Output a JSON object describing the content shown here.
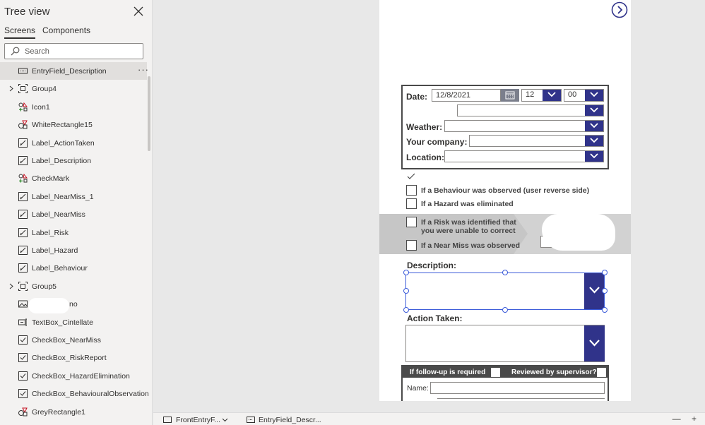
{
  "tree_panel": {
    "title": "Tree view",
    "tabs": [
      "Screens",
      "Components"
    ],
    "search_placeholder": "Search",
    "items": [
      {
        "label": "EntryField_Description",
        "icon": "text-input-icon",
        "selected": true,
        "expandable": false
      },
      {
        "label": "Group4",
        "icon": "group-icon",
        "selected": false,
        "expandable": true
      },
      {
        "label": "Icon1",
        "icon": "icon-control-icon",
        "selected": false,
        "expandable": false
      },
      {
        "label": "WhiteRectangle15",
        "icon": "shape-icon",
        "selected": false,
        "expandable": false
      },
      {
        "label": "Label_ActionTaken",
        "icon": "label-icon",
        "selected": false,
        "expandable": false
      },
      {
        "label": "Label_Description",
        "icon": "label-icon",
        "selected": false,
        "expandable": false
      },
      {
        "label": "CheckMark",
        "icon": "icon-control-icon",
        "selected": false,
        "expandable": false
      },
      {
        "label": "Label_NearMiss_1",
        "icon": "label-icon",
        "selected": false,
        "expandable": false
      },
      {
        "label": "Label_NearMiss",
        "icon": "label-icon",
        "selected": false,
        "expandable": false
      },
      {
        "label": "Label_Risk",
        "icon": "label-icon",
        "selected": false,
        "expandable": false
      },
      {
        "label": "Label_Hazard",
        "icon": "label-icon",
        "selected": false,
        "expandable": false
      },
      {
        "label": "Label_Behaviour",
        "icon": "label-icon",
        "selected": false,
        "expandable": false
      },
      {
        "label": "Group5",
        "icon": "group-icon",
        "selected": false,
        "expandable": true
      },
      {
        "label": "no",
        "icon": "image-icon",
        "selected": false,
        "expandable": false
      },
      {
        "label": "TextBox_Cintellate",
        "icon": "textbox-icon",
        "selected": false,
        "expandable": false
      },
      {
        "label": "CheckBox_NearMiss",
        "icon": "checkbox-icon",
        "selected": false,
        "expandable": false
      },
      {
        "label": "CheckBox_RiskReport",
        "icon": "checkbox-icon",
        "selected": false,
        "expandable": false
      },
      {
        "label": "CheckBox_HazardElimination",
        "icon": "checkbox-icon",
        "selected": false,
        "expandable": false
      },
      {
        "label": "CheckBox_BehaviouralObservation",
        "icon": "checkbox-icon",
        "selected": false,
        "expandable": false
      },
      {
        "label": "GreyRectangle1",
        "icon": "shape-icon",
        "selected": false,
        "expandable": false
      }
    ]
  },
  "form": {
    "date_label": "Date:",
    "date_value": "12/8/2021",
    "hour_value": "12",
    "minute_value": "00",
    "weather_label": "Weather:",
    "company_label": "Your company:",
    "location_label": "Location:",
    "checkboxes": [
      {
        "label": "If a Behaviour was observed (user reverse side)"
      },
      {
        "label": "If a Hazard was eliminated"
      },
      {
        "label": "If a Risk was identified that you were unable to correct"
      },
      {
        "label": "If a Near Miss was observed"
      }
    ],
    "description_label": "Description:",
    "action_label": "Action Taken:",
    "followup_label": "If follow-up is required",
    "supervisor_label": "Reviewed by supervisor?",
    "name_label": "Name:"
  },
  "bottom_bar": {
    "screen_crumb": "FrontEntryF...",
    "control_crumb": "EntryField_Descr...",
    "right_controls": "— +"
  },
  "colors": {
    "accent": "#30338a",
    "selection": "#3b5bd9",
    "panel_bg": "#f3f2f1",
    "canvas_bg": "#e8e8e8"
  }
}
